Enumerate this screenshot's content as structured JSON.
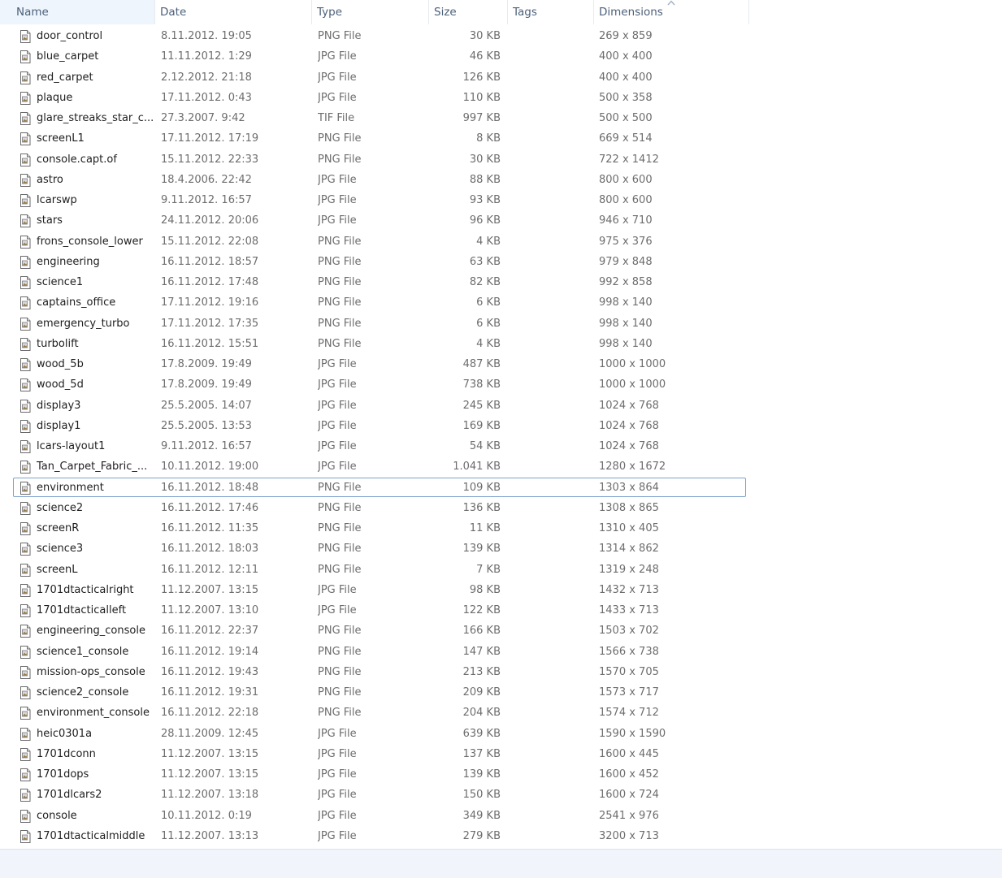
{
  "columns": {
    "name": "Name",
    "date": "Date",
    "type": "Type",
    "size": "Size",
    "tags": "Tags",
    "dimensions": "Dimensions"
  },
  "sort": {
    "column": "dimensions",
    "direction": "ascending",
    "icon": "sort-up-arrow-icon"
  },
  "accent_color": "#7da2ce",
  "selected_file": "environment",
  "files": [
    {
      "name": "door_control",
      "date": "8.11.2012. 19:05",
      "type": "PNG File",
      "size": "30 KB",
      "dims": "269 x 859",
      "icon": "png-file-icon"
    },
    {
      "name": "blue_carpet",
      "date": "11.11.2012. 1:29",
      "type": "JPG File",
      "size": "46 KB",
      "dims": "400 x 400",
      "icon": "jpg-file-icon"
    },
    {
      "name": "red_carpet",
      "date": "2.12.2012. 21:18",
      "type": "JPG File",
      "size": "126 KB",
      "dims": "400 x 400",
      "icon": "jpg-file-icon"
    },
    {
      "name": "plaque",
      "date": "17.11.2012. 0:43",
      "type": "JPG File",
      "size": "110 KB",
      "dims": "500 x 358",
      "icon": "jpg-file-icon"
    },
    {
      "name": "glare_streaks_star_c...",
      "date": "27.3.2007. 9:42",
      "type": "TIF File",
      "size": "997 KB",
      "dims": "500 x 500",
      "icon": "tif-file-icon"
    },
    {
      "name": "screenL1",
      "date": "17.11.2012. 17:19",
      "type": "PNG File",
      "size": "8 KB",
      "dims": "669 x 514",
      "icon": "png-file-icon"
    },
    {
      "name": "console.capt.of",
      "date": "15.11.2012. 22:33",
      "type": "PNG File",
      "size": "30 KB",
      "dims": "722 x 1412",
      "icon": "png-file-icon"
    },
    {
      "name": "astro",
      "date": "18.4.2006. 22:42",
      "type": "JPG File",
      "size": "88 KB",
      "dims": "800 x 600",
      "icon": "jpg-file-icon"
    },
    {
      "name": "lcarswp",
      "date": "9.11.2012. 16:57",
      "type": "JPG File",
      "size": "93 KB",
      "dims": "800 x 600",
      "icon": "jpg-file-icon"
    },
    {
      "name": "stars",
      "date": "24.11.2012. 20:06",
      "type": "JPG File",
      "size": "96 KB",
      "dims": "946 x 710",
      "icon": "jpg-file-icon"
    },
    {
      "name": "frons_console_lower",
      "date": "15.11.2012. 22:08",
      "type": "PNG File",
      "size": "4 KB",
      "dims": "975 x 376",
      "icon": "png-file-icon"
    },
    {
      "name": "engineering",
      "date": "16.11.2012. 18:57",
      "type": "PNG File",
      "size": "63 KB",
      "dims": "979 x 848",
      "icon": "png-file-icon"
    },
    {
      "name": "science1",
      "date": "16.11.2012. 17:48",
      "type": "PNG File",
      "size": "82 KB",
      "dims": "992 x 858",
      "icon": "png-file-icon"
    },
    {
      "name": "captains_office",
      "date": "17.11.2012. 19:16",
      "type": "PNG File",
      "size": "6 KB",
      "dims": "998 x 140",
      "icon": "png-file-icon"
    },
    {
      "name": "emergency_turbo",
      "date": "17.11.2012. 17:35",
      "type": "PNG File",
      "size": "6 KB",
      "dims": "998 x 140",
      "icon": "png-file-icon"
    },
    {
      "name": "turbolift",
      "date": "16.11.2012. 15:51",
      "type": "PNG File",
      "size": "4 KB",
      "dims": "998 x 140",
      "icon": "png-file-icon"
    },
    {
      "name": "wood_5b",
      "date": "17.8.2009. 19:49",
      "type": "JPG File",
      "size": "487 KB",
      "dims": "1000 x 1000",
      "icon": "jpg-file-icon"
    },
    {
      "name": "wood_5d",
      "date": "17.8.2009. 19:49",
      "type": "JPG File",
      "size": "738 KB",
      "dims": "1000 x 1000",
      "icon": "jpg-file-icon"
    },
    {
      "name": "display3",
      "date": "25.5.2005. 14:07",
      "type": "JPG File",
      "size": "245 KB",
      "dims": "1024 x 768",
      "icon": "jpg-file-icon"
    },
    {
      "name": "display1",
      "date": "25.5.2005. 13:53",
      "type": "JPG File",
      "size": "169 KB",
      "dims": "1024 x 768",
      "icon": "jpg-file-icon"
    },
    {
      "name": "lcars-layout1",
      "date": "9.11.2012. 16:57",
      "type": "JPG File",
      "size": "54 KB",
      "dims": "1024 x 768",
      "icon": "jpg-file-icon"
    },
    {
      "name": "Tan_Carpet_Fabric_...",
      "date": "10.11.2012. 19:00",
      "type": "JPG File",
      "size": "1.041 KB",
      "dims": "1280 x 1672",
      "icon": "jpg-file-icon"
    },
    {
      "name": "environment",
      "date": "16.11.2012. 18:48",
      "type": "PNG File",
      "size": "109 KB",
      "dims": "1303 x 864",
      "icon": "png-file-icon"
    },
    {
      "name": "science2",
      "date": "16.11.2012. 17:46",
      "type": "PNG File",
      "size": "136 KB",
      "dims": "1308 x 865",
      "icon": "png-file-icon"
    },
    {
      "name": "screenR",
      "date": "16.11.2012. 11:35",
      "type": "PNG File",
      "size": "11 KB",
      "dims": "1310 x 405",
      "icon": "png-file-icon"
    },
    {
      "name": "science3",
      "date": "16.11.2012. 18:03",
      "type": "PNG File",
      "size": "139 KB",
      "dims": "1314 x 862",
      "icon": "png-file-icon"
    },
    {
      "name": "screenL",
      "date": "16.11.2012. 12:11",
      "type": "PNG File",
      "size": "7 KB",
      "dims": "1319 x 248",
      "icon": "png-file-icon"
    },
    {
      "name": "1701dtacticalright",
      "date": "11.12.2007. 13:15",
      "type": "JPG File",
      "size": "98 KB",
      "dims": "1432 x 713",
      "icon": "jpg-file-icon"
    },
    {
      "name": "1701dtacticalleft",
      "date": "11.12.2007. 13:10",
      "type": "JPG File",
      "size": "122 KB",
      "dims": "1433 x 713",
      "icon": "jpg-file-icon"
    },
    {
      "name": "engineering_console",
      "date": "16.11.2012. 22:37",
      "type": "PNG File",
      "size": "166 KB",
      "dims": "1503 x 702",
      "icon": "png-file-icon"
    },
    {
      "name": "science1_console",
      "date": "16.11.2012. 19:14",
      "type": "PNG File",
      "size": "147 KB",
      "dims": "1566 x 738",
      "icon": "png-file-icon"
    },
    {
      "name": "mission-ops_console",
      "date": "16.11.2012. 19:43",
      "type": "PNG File",
      "size": "213 KB",
      "dims": "1570 x 705",
      "icon": "png-file-icon"
    },
    {
      "name": "science2_console",
      "date": "16.11.2012. 19:31",
      "type": "PNG File",
      "size": "209 KB",
      "dims": "1573 x 717",
      "icon": "png-file-icon"
    },
    {
      "name": "environment_console",
      "date": "16.11.2012. 22:18",
      "type": "PNG File",
      "size": "204 KB",
      "dims": "1574 x 712",
      "icon": "png-file-icon"
    },
    {
      "name": "heic0301a",
      "date": "28.11.2009. 12:45",
      "type": "JPG File",
      "size": "639 KB",
      "dims": "1590 x 1590",
      "icon": "jpg-file-icon"
    },
    {
      "name": "1701dconn",
      "date": "11.12.2007. 13:15",
      "type": "JPG File",
      "size": "137 KB",
      "dims": "1600 x 445",
      "icon": "jpg-file-icon"
    },
    {
      "name": "1701dops",
      "date": "11.12.2007. 13:15",
      "type": "JPG File",
      "size": "139 KB",
      "dims": "1600 x 452",
      "icon": "jpg-file-icon"
    },
    {
      "name": "1701dlcars2",
      "date": "11.12.2007. 13:18",
      "type": "JPG File",
      "size": "150 KB",
      "dims": "1600 x 724",
      "icon": "jpg-file-icon"
    },
    {
      "name": "console",
      "date": "10.11.2012. 0:19",
      "type": "JPG File",
      "size": "349 KB",
      "dims": "2541 x 976",
      "icon": "jpg-file-icon"
    },
    {
      "name": "1701dtacticalmiddle",
      "date": "11.12.2007. 13:13",
      "type": "JPG File",
      "size": "279 KB",
      "dims": "3200 x 713",
      "icon": "jpg-file-icon"
    }
  ]
}
